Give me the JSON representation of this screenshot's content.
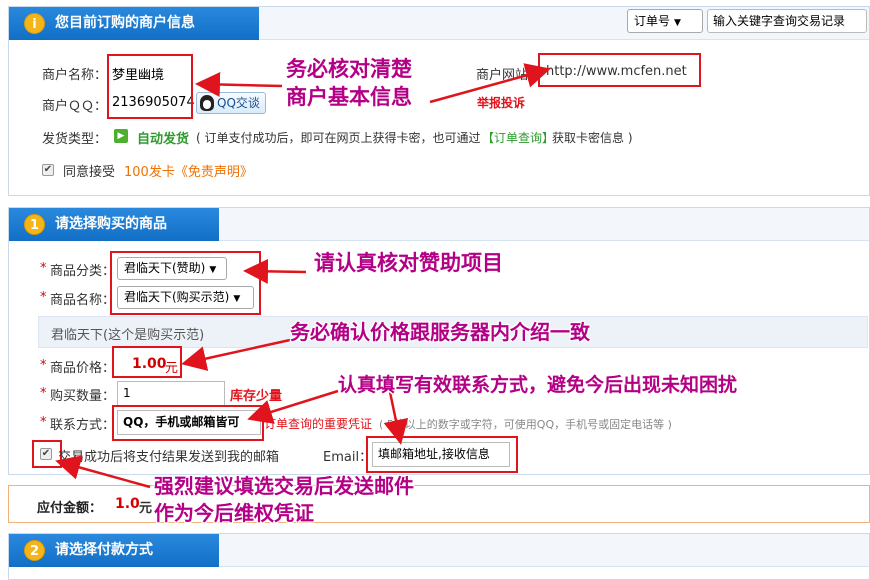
{
  "top": {
    "query_select": "订单号",
    "query_input_placeholder": "输入关键字查询交易记录"
  },
  "merchant": {
    "title": "您目前订购的商户信息",
    "name_label": "商户名称：",
    "name_value": "梦里幽境",
    "qq_label": "商户ＱＱ：",
    "qq_value": "2136905074",
    "qq_button": "QQ交谈",
    "site_label": "商户网站：",
    "site_value": "http://www.mcfen.net",
    "report_link": "举报投诉",
    "ship_label": "发货类型：",
    "ship_value": "自动发货",
    "ship_desc_1": "( 订单支付成功后，即可在网页上获得卡密，也可通过",
    "ship_desc_link": "【订单查询】",
    "ship_desc_2": "获取卡密信息 )",
    "agree_text": "同意接受",
    "agree_link": "100发卡《免责声明》"
  },
  "product": {
    "step": "1",
    "title": "请选择购买的商品",
    "category_label": "商品分类：",
    "category_value": "君临天下(赞助)",
    "name_label": "商品名称：",
    "name_value": "君临天下(购买示范)",
    "desc": "君临天下(这个是购买示范)",
    "price_label": "商品价格：",
    "price_value": "1.00",
    "price_unit": "元",
    "qty_label": "购买数量：",
    "qty_value": "1",
    "stock_text": "库存少量",
    "contact_label": "联系方式：",
    "contact_value": "QQ，手机或邮箱皆可",
    "contact_hint_red": "订单查询的重要凭证",
    "contact_hint_gray": "( 5位以上的数字或字符，可使用QQ，手机号或固定电话等 )",
    "email_check_text": "交易成功后将支付结果发送到我的邮箱",
    "email_label": "Email：",
    "email_value": "填邮箱地址,接收信息",
    "required_mark": "*"
  },
  "total": {
    "label": "应付金额：",
    "value": "1.0",
    "unit": "元"
  },
  "payment": {
    "step": "2",
    "title": "请选择付款方式"
  },
  "annotations": {
    "a1_line1": "务必核对清楚",
    "a1_line2": "商户基本信息",
    "a2": "请认真核对赞助项目",
    "a3": "务必确认价格跟服务器内介绍一致",
    "a4": "认真填写有效联系方式，避免今后出现未知困扰",
    "a5_line1": "强烈建议填选交易后发送邮件",
    "a5_line2": "作为今后维权凭证"
  },
  "colors": {
    "header_blue": "#1a7fd6",
    "annotation": "#b40085",
    "highlight_red": "#e0141c",
    "price_red": "#d40000",
    "stock_orange": "#f07000"
  }
}
